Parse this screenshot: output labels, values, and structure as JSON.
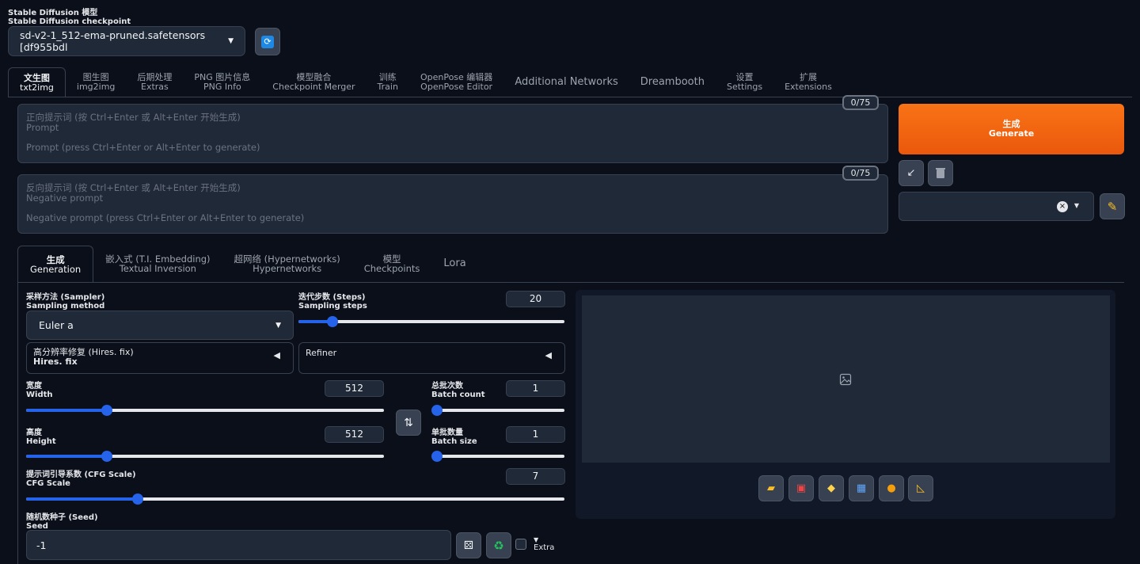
{
  "checkpoint": {
    "label_cn": "Stable Diffusion 模型",
    "label_en": "Stable Diffusion checkpoint",
    "value": "sd-v2-1_512-ema-pruned.safetensors [df955bdl",
    "refresh_icon": "refresh-icon"
  },
  "tabs": [
    {
      "cn": "文生图",
      "en": "txt2img"
    },
    {
      "cn": "图生图",
      "en": "img2img"
    },
    {
      "cn": "后期处理",
      "en": "Extras"
    },
    {
      "cn": "PNG 图片信息",
      "en": "PNG Info"
    },
    {
      "cn": "模型融合",
      "en": "Checkpoint Merger"
    },
    {
      "cn": "训练",
      "en": "Train"
    },
    {
      "cn": "OpenPose 编辑器",
      "en": "OpenPose Editor"
    },
    {
      "cn": "Additional Networks",
      "en": ""
    },
    {
      "cn": "Dreambooth",
      "en": ""
    },
    {
      "cn": "设置",
      "en": "Settings"
    },
    {
      "cn": "扩展",
      "en": "Extensions"
    }
  ],
  "prompt": {
    "counter": "0/75",
    "placeholder_cn": "正向提示词 (按 Ctrl+Enter 或 Alt+Enter 开始生成)",
    "placeholder_label": "Prompt",
    "placeholder_en": "Prompt (press Ctrl+Enter or Alt+Enter to generate)"
  },
  "negative_prompt": {
    "counter": "0/75",
    "placeholder_cn": "反向提示词 (按 Ctrl+Enter 或 Alt+Enter 开始生成)",
    "placeholder_label": "Negative prompt",
    "placeholder_en": "Negative prompt (press Ctrl+Enter or Alt+Enter to generate)"
  },
  "generate": {
    "cn": "生成",
    "en": "Generate"
  },
  "tool_icons": [
    "arrow-icon",
    "trash-icon",
    "pencil-icon"
  ],
  "subtabs": [
    {
      "cn": "生成",
      "en": "Generation"
    },
    {
      "cn": "嵌入式 (T.I. Embedding)",
      "en": "Textual Inversion"
    },
    {
      "cn": "超网络 (Hypernetworks)",
      "en": "Hypernetworks"
    },
    {
      "cn": "模型",
      "en": "Checkpoints"
    },
    {
      "cn": "Lora",
      "en": ""
    }
  ],
  "sampler": {
    "label_cn": "采样方法 (Sampler)",
    "label_en": "Sampling method",
    "value": "Euler a"
  },
  "steps": {
    "label_cn": "迭代步数 (Steps)",
    "label_en": "Sampling steps",
    "value": "20",
    "min": 1,
    "max": 150,
    "num": 20
  },
  "hires": {
    "label_cn": "高分辨率修复 (Hires. fix)",
    "label_en": "Hires. fix"
  },
  "refiner": {
    "label": "Refiner"
  },
  "width": {
    "label_cn": "宽度",
    "label_en": "Width",
    "value": "512",
    "min": 64,
    "max": 2048,
    "num": 512
  },
  "height": {
    "label_cn": "高度",
    "label_en": "Height",
    "value": "512",
    "min": 64,
    "max": 2048,
    "num": 512
  },
  "batch_count": {
    "label_cn": "总批次数",
    "label_en": "Batch count",
    "value": "1",
    "min": 1,
    "max": 100,
    "num": 1
  },
  "batch_size": {
    "label_cn": "单批数量",
    "label_en": "Batch size",
    "value": "1",
    "min": 1,
    "max": 8,
    "num": 1
  },
  "cfg": {
    "label_cn": "提示词引导系数 (CFG Scale)",
    "label_en": "CFG Scale",
    "value": "7",
    "min": 1,
    "max": 30,
    "num": 7
  },
  "seed": {
    "label_cn": "随机数种子 (Seed)",
    "label_en": "Seed",
    "value": "-1",
    "extra": "Extra"
  },
  "output_buttons": [
    "folder-icon",
    "save-icon",
    "zip-icon",
    "send-to-img2img-icon",
    "send-to-inpaint-icon",
    "send-to-extras-icon"
  ],
  "colors": {
    "accent": "#f97316",
    "slider": "#2563eb",
    "bg": "#0b0f19",
    "panel": "#1f2937"
  }
}
